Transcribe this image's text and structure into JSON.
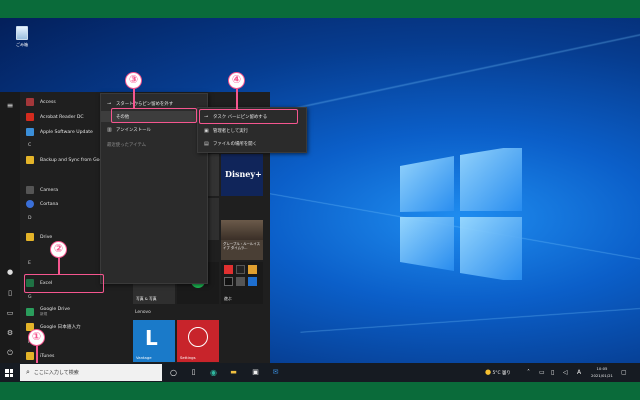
{
  "desktop": {
    "recycle_bin_label": "ごみ箱"
  },
  "start_menu": {
    "apps": [
      {
        "label": "Access",
        "color": "#a4373a"
      },
      {
        "label": "Acrobat Reader DC",
        "color": "#d42b1e"
      },
      {
        "label": "Apple Software Update",
        "color": "#3b8fd9"
      },
      {
        "label": "Backup and Sync from Goo...",
        "color": "#e4b429"
      },
      {
        "label": "Camera",
        "color": "#555555"
      },
      {
        "label": "Cortana",
        "color": "#3a6fd8"
      },
      {
        "label": "Drive",
        "color": "#e4b429"
      },
      {
        "label": "Excel",
        "color": "#1f7244"
      },
      {
        "label": "Google Drive",
        "color": "#2a9d5c",
        "sub": "新規"
      },
      {
        "label": "Google 日本語入力",
        "color": "#e4b429"
      },
      {
        "label": "Google 日本語入力",
        "color": "#3b8fd9"
      },
      {
        "label": "iTunes",
        "color": "#e4b429"
      }
    ],
    "letters": [
      "C",
      "D",
      "E",
      "G",
      "I"
    ],
    "tiles_section_label": "Lenovo",
    "tiles": {
      "disney_plus": "Disney+",
      "news": "グレープル・ルールイスイブ タイムラ...",
      "news_label": "グルメ",
      "photos_label": "写真 & 写真",
      "game_label": "遊ぶ",
      "vantage": "Vantage",
      "settings": "Settings"
    }
  },
  "context_menu": {
    "items": [
      {
        "label": "スタートからピン留めを外す",
        "icon": "unpin-icon"
      },
      {
        "label": "その他",
        "icon": "more-icon"
      },
      {
        "label": "アンインストール",
        "icon": "trash-icon"
      },
      {
        "label": "最近使ったアイテム",
        "icon": ""
      }
    ]
  },
  "submenu": {
    "items": [
      {
        "label": "タスク バーにピン留めする",
        "icon": "pin-icon"
      },
      {
        "label": "管理者として実行",
        "icon": "shield-icon"
      },
      {
        "label": "ファイルの場所を開く",
        "icon": "folder-icon"
      }
    ]
  },
  "callouts": [
    "①",
    "②",
    "③",
    "④"
  ],
  "taskbar": {
    "search_placeholder": "ここに入力して検索",
    "weather": "5°C 曇り",
    "ime": "A",
    "time": "10:05",
    "date": "2021/01/21"
  },
  "colors": {
    "frame": "#0a6b3a",
    "highlight": "#f5568f",
    "menu_bg": "#2b2b2b"
  }
}
